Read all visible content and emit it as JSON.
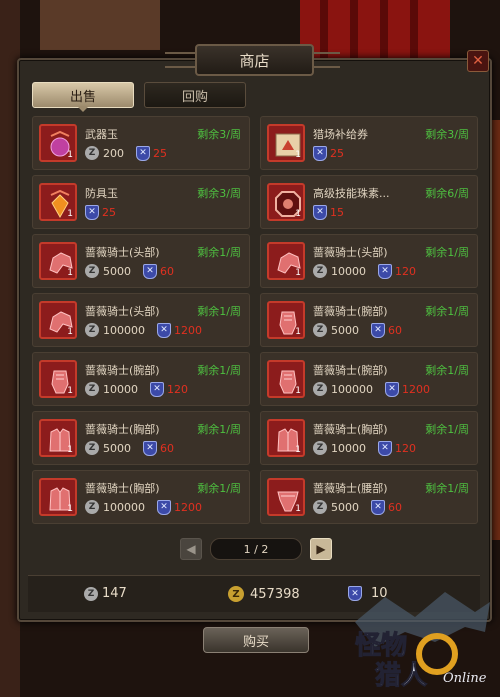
{
  "window": {
    "title": "商店",
    "close_icon": "close-x-icon"
  },
  "tabs": [
    {
      "label": "出售",
      "active": true
    },
    {
      "label": "回购",
      "active": false
    }
  ],
  "items": [
    {
      "name": "武器玉",
      "icon": "orb-icon",
      "qty": "1",
      "remain": "剩余3/周",
      "zeny": "200",
      "medal": "25"
    },
    {
      "name": "猎场补给券",
      "icon": "ticket-icon",
      "qty": "1",
      "remain": "剩余3/周",
      "zeny": "",
      "medal": "25"
    },
    {
      "name": "防具玉",
      "icon": "gem-icon",
      "qty": "1",
      "remain": "剩余3/周",
      "zeny": "",
      "medal": "25"
    },
    {
      "name": "高级技能珠素...",
      "icon": "octagon-jewel-icon",
      "qty": "1",
      "remain": "剩余6/周",
      "zeny": "",
      "medal": "15"
    },
    {
      "name": "蔷薇骑士(头部)",
      "icon": "helmet-icon",
      "qty": "1",
      "remain": "剩余1/周",
      "zeny": "5000",
      "medal": "60"
    },
    {
      "name": "蔷薇骑士(头部)",
      "icon": "helmet-icon",
      "qty": "1",
      "remain": "剩余1/周",
      "zeny": "10000",
      "medal": "120"
    },
    {
      "name": "蔷薇骑士(头部)",
      "icon": "helmet-icon",
      "qty": "1",
      "remain": "剩余1/周",
      "zeny": "100000",
      "medal": "1200"
    },
    {
      "name": "蔷薇骑士(腕部)",
      "icon": "gauntlet-icon",
      "qty": "1",
      "remain": "剩余1/周",
      "zeny": "5000",
      "medal": "60"
    },
    {
      "name": "蔷薇骑士(腕部)",
      "icon": "gauntlet-icon",
      "qty": "1",
      "remain": "剩余1/周",
      "zeny": "10000",
      "medal": "120"
    },
    {
      "name": "蔷薇骑士(腕部)",
      "icon": "gauntlet-icon",
      "qty": "1",
      "remain": "剩余1/周",
      "zeny": "100000",
      "medal": "1200"
    },
    {
      "name": "蔷薇骑士(胸部)",
      "icon": "chest-armor-icon",
      "qty": "1",
      "remain": "剩余1/周",
      "zeny": "5000",
      "medal": "60"
    },
    {
      "name": "蔷薇骑士(胸部)",
      "icon": "chest-armor-icon",
      "qty": "1",
      "remain": "剩余1/周",
      "zeny": "10000",
      "medal": "120"
    },
    {
      "name": "蔷薇骑士(胸部)",
      "icon": "chest-armor-icon",
      "qty": "1",
      "remain": "剩余1/周",
      "zeny": "100000",
      "medal": "1200"
    },
    {
      "name": "蔷薇骑士(腰部)",
      "icon": "waist-armor-icon",
      "qty": "1",
      "remain": "剩余1/周",
      "zeny": "5000",
      "medal": "60"
    }
  ],
  "pagination": {
    "label": "1 / 2"
  },
  "wallet": {
    "zeny_silver": "147",
    "zeny_gold": "457398",
    "medals": "10"
  },
  "buy_button": "购买",
  "logo": {
    "text": "怪物猎人",
    "sub": "Online"
  },
  "currency_glyph": "Z",
  "colors": {
    "accent_green": "#4ec040",
    "price_red": "#e03020",
    "item_red": "#8c1c1c"
  }
}
